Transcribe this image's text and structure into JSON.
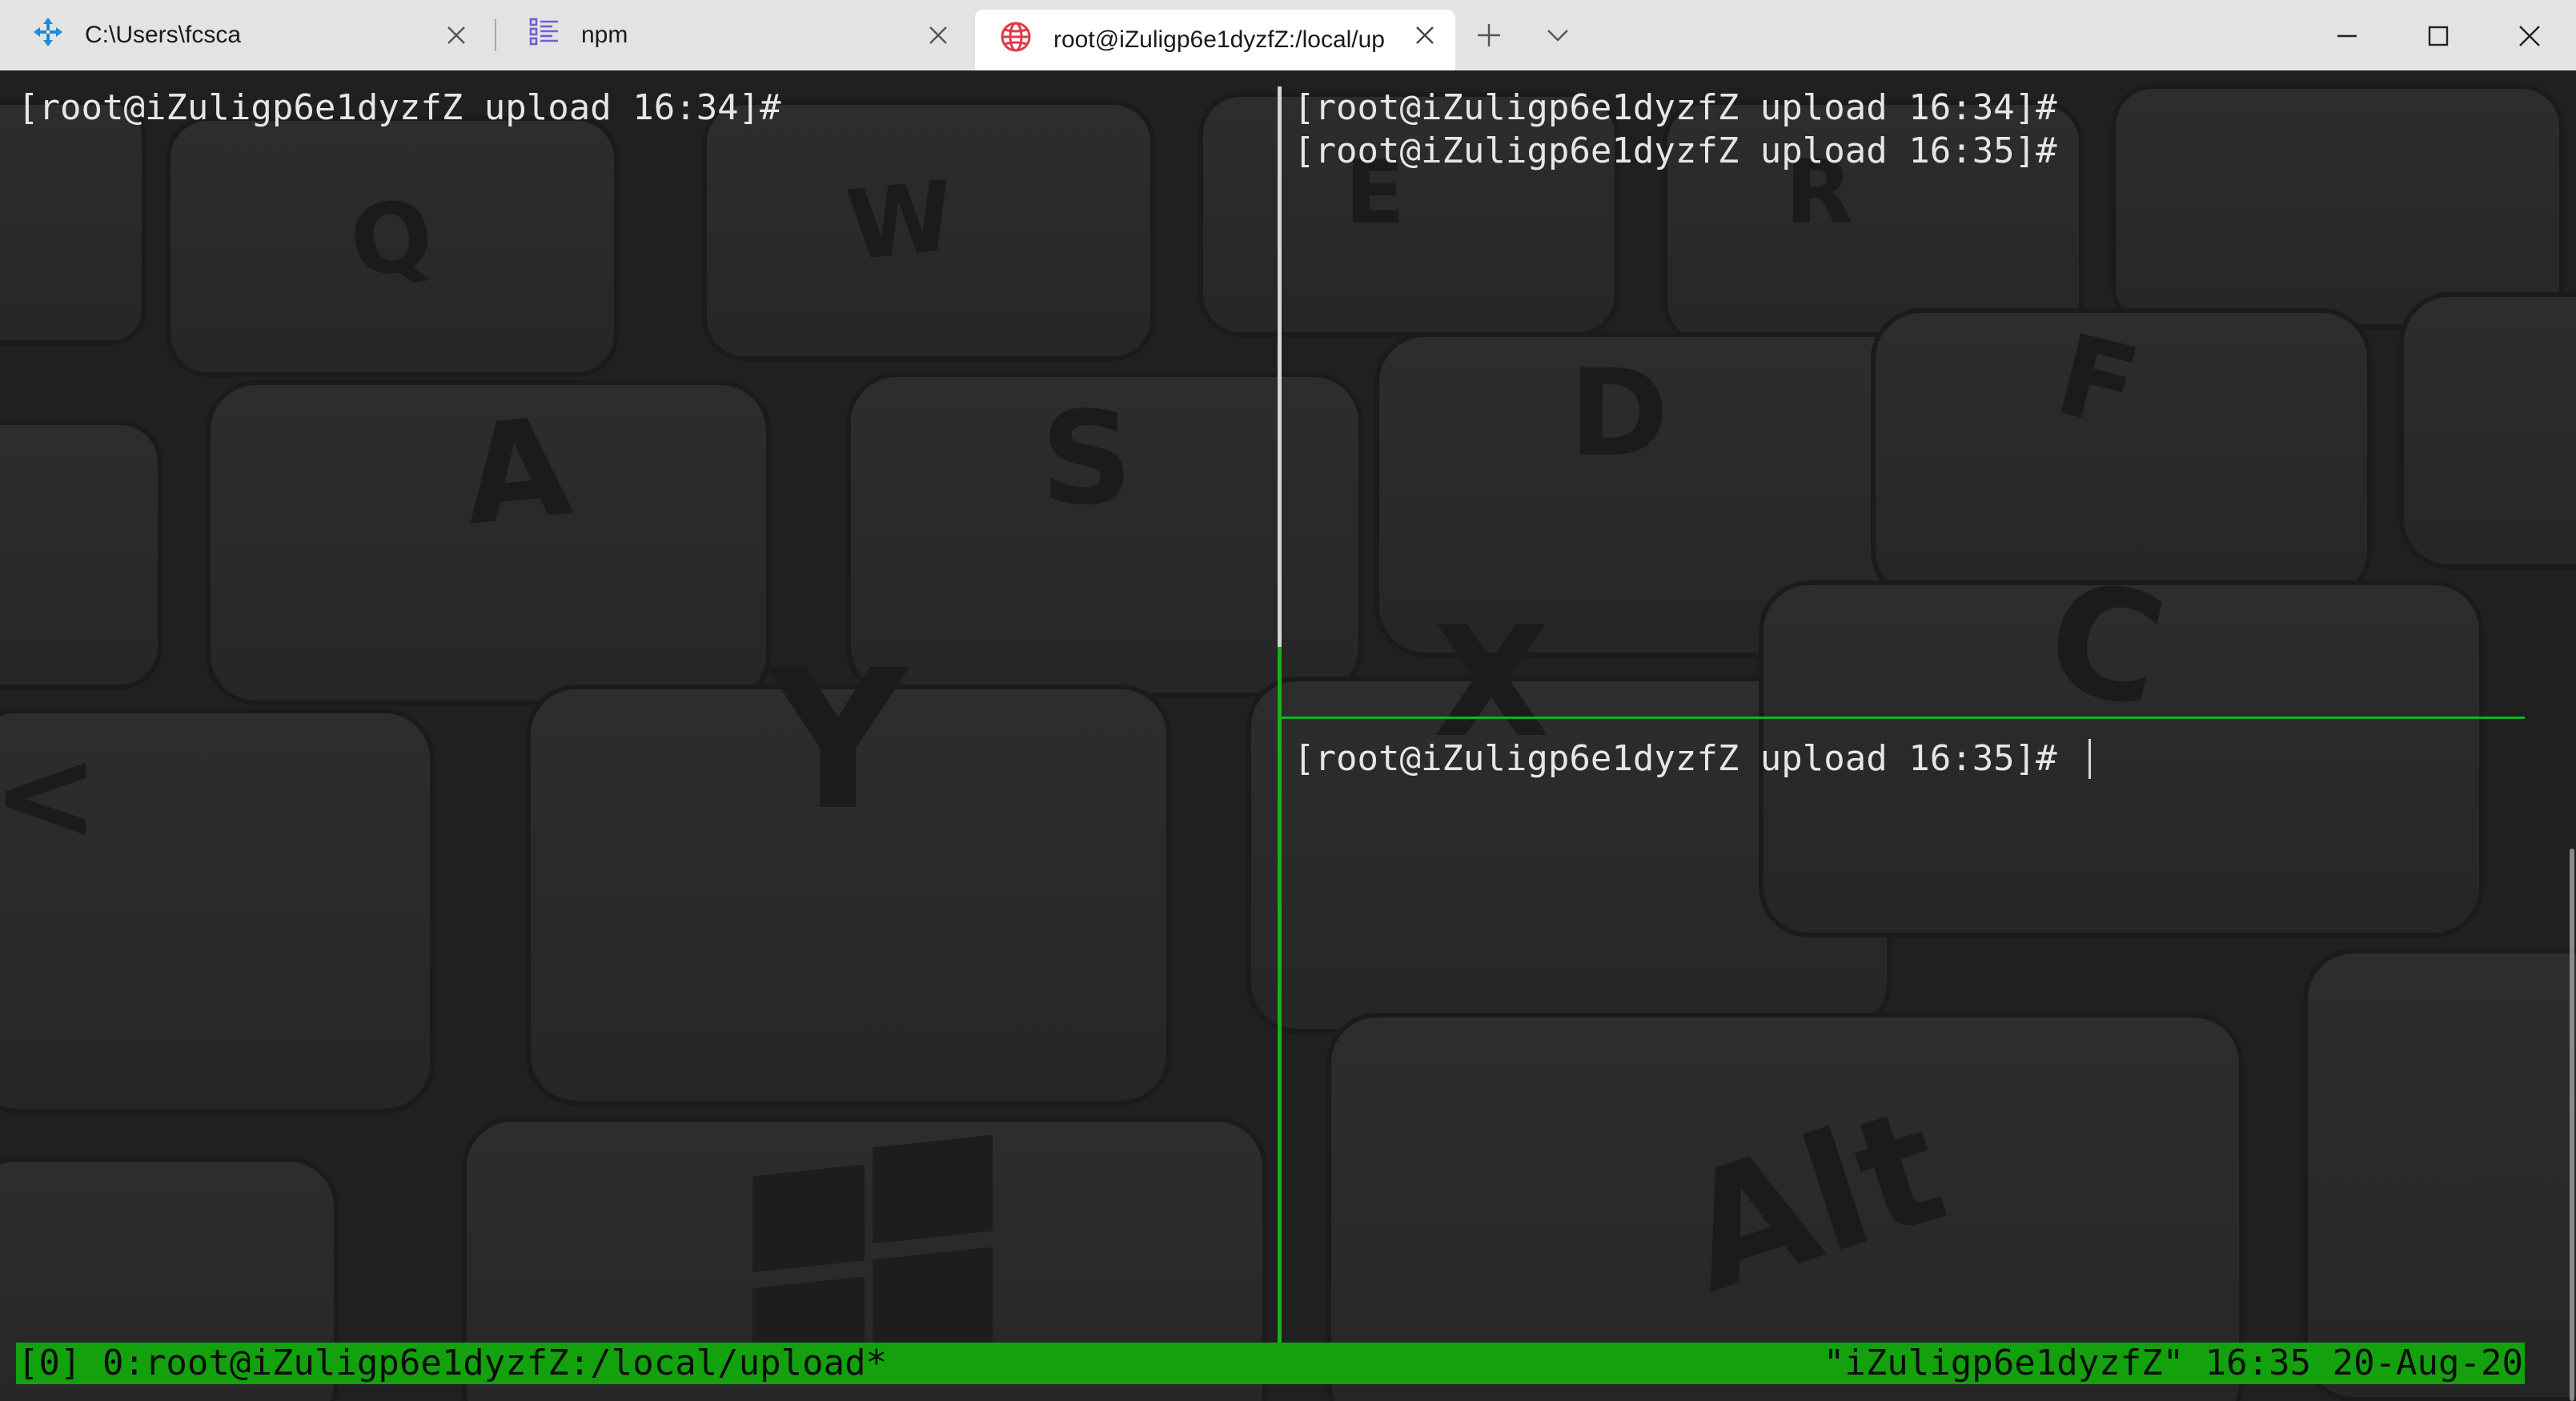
{
  "tabs": [
    {
      "title": "C:\\Users\\fcsca",
      "icon": "azure-arrows-icon",
      "active": false
    },
    {
      "title": "npm",
      "icon": "list-icon",
      "active": false
    },
    {
      "title": "root@iZuligp6e1dyzfZ:/local/up",
      "icon": "globe-icon",
      "active": true
    }
  ],
  "titlebar": {
    "new_tab_icon": "plus-icon",
    "dropdown_icon": "chevron-down-icon",
    "window_controls": [
      "minimize-icon",
      "maximize-icon",
      "close-icon"
    ]
  },
  "panes": {
    "left": {
      "lines": [
        "[root@iZuligp6e1dyzfZ upload 16:34]#"
      ]
    },
    "top_right": {
      "lines": [
        "[root@iZuligp6e1dyzfZ upload 16:34]#",
        "[root@iZuligp6e1dyzfZ upload 16:35]#"
      ]
    },
    "bottom_right": {
      "lines": [
        "[root@iZuligp6e1dyzfZ upload 16:35]# "
      ]
    }
  },
  "statusbar": {
    "left": "[0] 0:root@iZuligp6e1dyzfZ:/local/upload*",
    "right": "\"iZuligp6e1dyzfZ\" 16:35 20-Aug-20"
  },
  "colors": {
    "accent_green": "#13a10e",
    "split_line_active": "#19b01b",
    "titlebar_bg": "#e3e3e3",
    "terminal_text": "#e6e6e6",
    "globe_icon": "#e0394b",
    "azure_icon": "#1f8ad6",
    "list_icon": "#6f5fd1"
  }
}
